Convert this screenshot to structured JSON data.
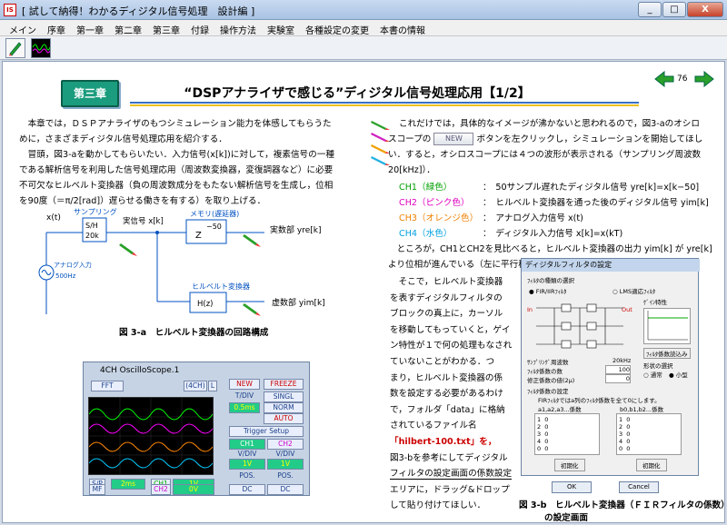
{
  "window": {
    "app_icon": "IS",
    "title": "[ 試して納得！わかるディジタル信号処理　設計編 ]",
    "btn_min": "_",
    "btn_max": "□",
    "btn_close": "X"
  },
  "menu": [
    "メイン",
    "序章",
    "第一章",
    "第二章",
    "第三章",
    "付録",
    "操作方法",
    "実験室",
    "各種設定の変更",
    "本書の情報"
  ],
  "toolbar": {
    "tools": [
      "pen-icon",
      "oscilloscope-icon"
    ],
    "scope_label": "OscPh"
  },
  "page": {
    "chapter": "第三章",
    "title": "“DSPアナライザで感じる”ディジタル信号処理応用【1/2】",
    "page_number": "76",
    "left_paragraph": [
      "　本章では，ＤＳＰアナライザのもつシミュレーション能力を体感してもらうた",
      "めに，さまざまディジタル信号処理応用を紹介する．",
      "　冒頭，図3-aを動かしてもらいたい．入力信号(x[k])に対して，複素信号の一種",
      "である解析信号を利用した信号処理応用（周波数変換器，変復調器など）に必要",
      "不可欠なヒルベルト変換器（負の周波数成分をもたない解析信号を生成し，位相",
      "を90度（＝π/2[rad]）遅らせる働きを有する）を取り上げる．"
    ],
    "right_intro": [
      "これだけでは，具体的なイメージが沸かないと思われるので，図3-aのオシロ",
      "ボタンを左クリックし，シミュレーションを開始してほし",
      "い．すると，オシロスコープには４つの波形が表示される（サンプリング周波数",
      "20[kHz]）．"
    ],
    "right_intro_prefix": "スコープの",
    "new_button": "NEW",
    "channels": [
      {
        "label": "CH1（緑色）",
        "color": "#00a000",
        "desc": "：　50サンプル遅れたディジタル信号 yre[k]=x[k−50]"
      },
      {
        "label": "CH2（ピンク色）",
        "color": "#e000c0",
        "desc": "：　ヒルベルト変換器を通った後のディジタル信号 yim[k]"
      },
      {
        "label": "CH3（オレンジ色）",
        "color": "#f08000",
        "desc": "：　アナログ入力信号 x(t)"
      },
      {
        "label": "CH4（水色）",
        "color": "#00a0e0",
        "desc": "：　ディジタル入力信号 x[k]=x(kT)"
      }
    ],
    "after_channels": [
      "　ところが，CH1とCH2を見比べると，ヒルベルト変換器の出力 yim[k] が yre[k]",
      "より位相が進んでいる（左に平行移動した）信号ではないか？"
    ],
    "right_column": [
      "　そこで，ヒルベルト変換器",
      "を表すディジタルフィルタの",
      "ブロックの真上に，カーソル",
      "を移動してもっていくと，ゲイ",
      "ン特性が１で何の処理もなされ",
      "ていないことがわかる．つ",
      "まり，ヒルベルト変換器の係",
      "数を設定する必要があるわけ",
      "で，フォルダ「data」に格納",
      "されているファイル名",
      "「hilbert-100.txt」を，",
      "図3-bを参考にしてディジタル",
      "フィルタの設定画面の係数設定",
      "エリアに，ドラッグ&ドロップ",
      "して貼り付けてほしい．"
    ],
    "caption_a": "図 3-a　ヒルベルト変換器の回路構成",
    "caption_b1": "図 3-b　ヒルベルト変換器（ＦＩＲフィルタの係数）",
    "caption_b2": "の設定画面"
  },
  "diagram": {
    "x_t": "x(t)",
    "sampling": "サンプリング",
    "sh": "S/H",
    "sh_rate": "20k",
    "input_signal": "実信号 x[k]",
    "memory": "メモリ(遅延器)",
    "delay": "−50",
    "z": "Z",
    "real_out": "実数部 yre[k]",
    "analog_in": "アナログ入力",
    "freq": "500Hz",
    "hilbert_label": "ヒルベルト変換器",
    "hilbert_box": "H(z)",
    "imag_out": "虚数部 yim[k]"
  },
  "oscilloscope": {
    "title": "4CH OscilloScope.1",
    "fft": "FFT",
    "ch4": "(4CH)",
    "l": "L",
    "new": "NEW",
    "freeze": "FREEZE",
    "tdiv": "T/DIV",
    "singl": "SINGL",
    "tdiv_val": "0.5ms",
    "norm": "NORM",
    "auto": "AUTO",
    "trigger": "Trigger Setup",
    "ch1": "CH1",
    "ch2": "CH2",
    "vdiv1": "V/DIV",
    "vdiv2": "V/DIV",
    "v1": "1V",
    "v2": "1V",
    "pos1": "POS.",
    "pos2": "POS.",
    "dc1": "DC",
    "dc2": "DC",
    "sp": "S/P",
    "mf": "MF",
    "ms2": "2ms",
    "ch1b": "CH1",
    "ch2b": "CH2",
    "v1b": "1V",
    "v0": "0V"
  },
  "dialog": {
    "title": "ディジタルフィルタの設定",
    "filter_select": "ﾌｨﾙﾀの種類の選択",
    "fir": "FIR/IIRﾌｨﾙﾀ",
    "lms": "LMS適応ﾌｨﾙﾀ",
    "gain": "ｹﾞｲﾝ特性",
    "in": "In",
    "out": "Out",
    "read_btn": "ﾌｨﾙﾀ係数読込み",
    "fs": "ｻﾝﾌﾟﾘﾝｸﾞ周波数",
    "fs_val": "20kHz",
    "order": "ﾌｨﾙﾀ係数の数",
    "order_val": "100",
    "mu": "修正係数の値(2μ)",
    "mu_val": "0",
    "shape": "形状の選択",
    "normal": "通常",
    "small": "小型",
    "coef_set": "ﾌｨﾙﾀ係数の設定",
    "coef_note": "FIRﾌｨﾙﾀではa列のﾌｨﾙﾀ係数を全て0にします。",
    "a_col": "a1,a2,a3...係数",
    "b_col": "b0,b1,b2...係数",
    "a_vals": [
      "0",
      "0",
      "0",
      "0",
      "0"
    ],
    "b_vals": [
      "0",
      "0",
      "0",
      "0",
      "0"
    ],
    "rows": [
      "1",
      "2",
      "3",
      "4",
      "0"
    ],
    "init1": "初期化",
    "init2": "初期化",
    "ok": "OK",
    "cancel": "Cancel"
  }
}
